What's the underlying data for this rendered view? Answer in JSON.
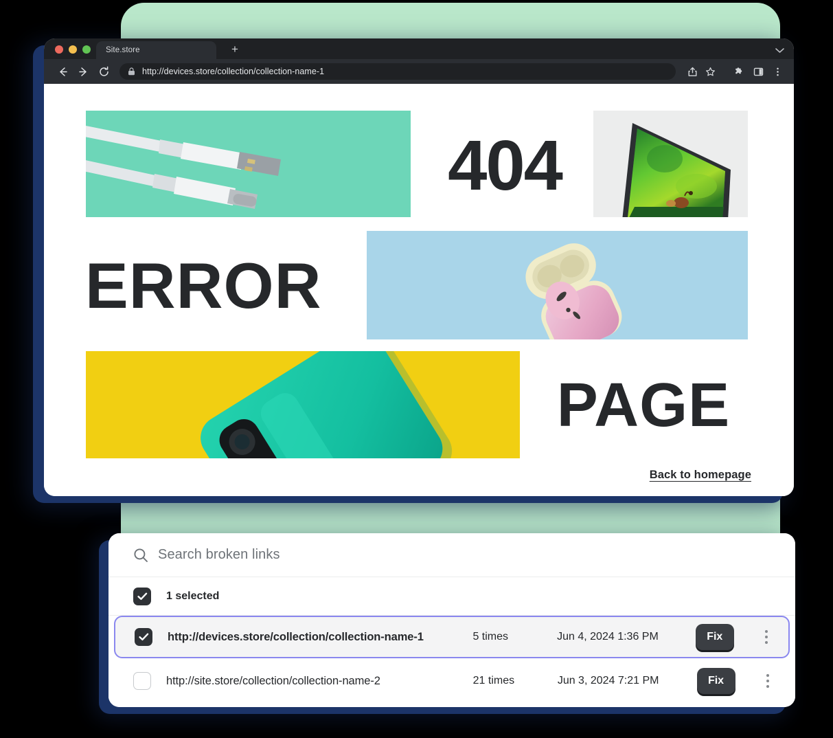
{
  "browser": {
    "tab_title": "Site.store",
    "new_tab_label": "+",
    "url": "http://devices.store/collection/collection-name-1",
    "icons": {
      "back": "back-arrow-icon",
      "forward": "forward-arrow-icon",
      "reload": "reload-icon",
      "lock": "lock-icon",
      "share": "share-icon",
      "bookmark": "star-icon",
      "extensions": "puzzle-icon",
      "side_panel": "side-panel-icon",
      "menu": "three-dot-menu-icon",
      "tab_list": "chevron-down-icon"
    },
    "window_controls": [
      "close-red",
      "minimize-yellow",
      "zoom-green"
    ]
  },
  "error_page": {
    "code": "404",
    "word_error": "ERROR",
    "word_page": "PAGE",
    "home_link": "Back to homepage",
    "tiles": [
      {
        "name": "usb-cables-photo",
        "bg": "#6dd6b8"
      },
      {
        "name": "tv-screen-photo",
        "bg": "#eceded"
      },
      {
        "name": "earbuds-photo",
        "bg": "#a9d5e9"
      },
      {
        "name": "phone-photo",
        "bg": "#f1cf12"
      }
    ]
  },
  "broken_links_panel": {
    "search": {
      "placeholder": "Search broken links",
      "value": "",
      "icon": "search-icon"
    },
    "selection": {
      "label": "1 selected",
      "checked": true
    },
    "columns": [
      "url",
      "times",
      "when",
      "action"
    ],
    "rows": [
      {
        "checked": true,
        "selected": true,
        "url": "http://devices.store/collection/collection-name-1",
        "times": "5 times",
        "when": "Jun 4, 2024 1:36 PM",
        "fix_label": "Fix",
        "menu_icon": "three-dot-menu-icon"
      },
      {
        "checked": false,
        "selected": false,
        "url": "http://site.store/collection/collection-name-2",
        "times": "21 times",
        "when": "Jun 3, 2024 7:21 PM",
        "fix_label": "Fix",
        "menu_icon": "three-dot-menu-icon"
      }
    ]
  },
  "decor": {
    "mint_card_color": "#b9e7ca",
    "shadow_color": "#1c3468",
    "accent_selected": "#8a87ef",
    "arrow": "curved-arrow-icon"
  }
}
